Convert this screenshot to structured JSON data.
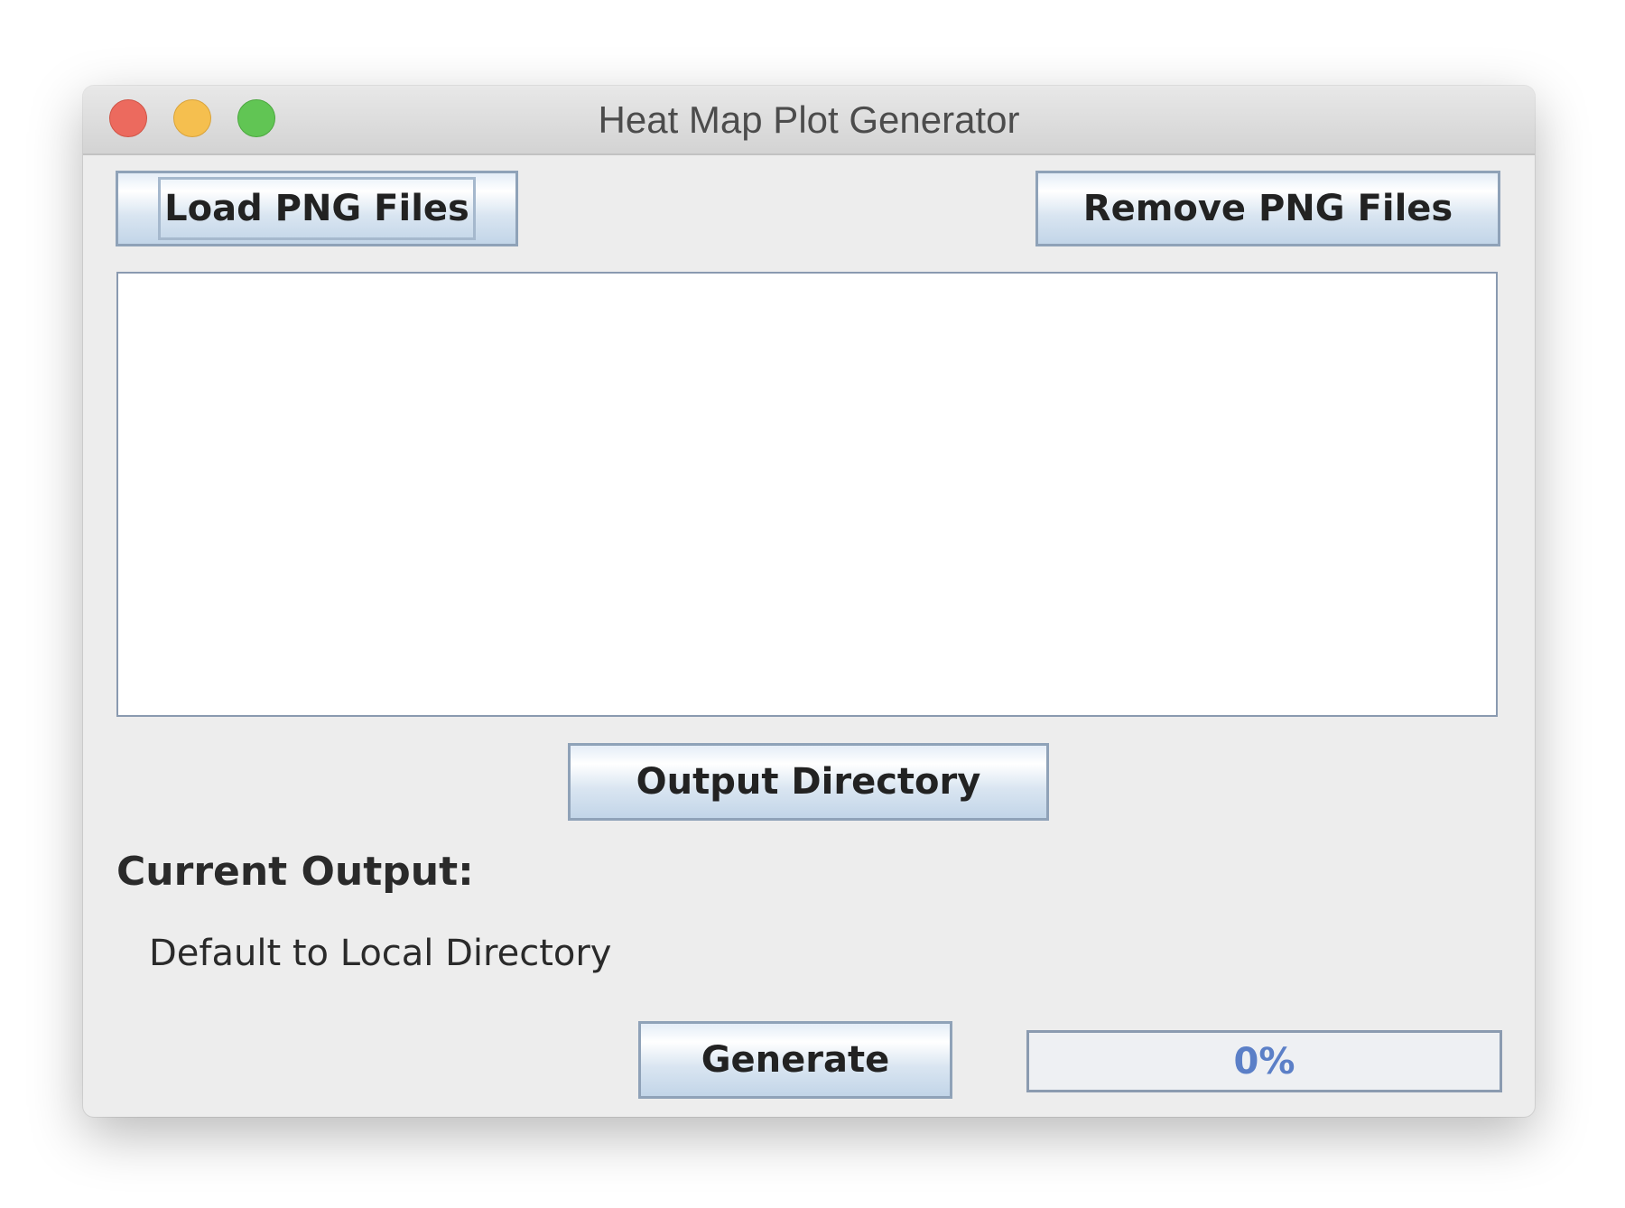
{
  "window": {
    "title": "Heat Map Plot Generator"
  },
  "toolbar": {
    "load_label": "Load PNG Files",
    "remove_label": "Remove PNG Files"
  },
  "file_list": {
    "items": []
  },
  "output": {
    "directory_button": "Output Directory",
    "current_label": "Current Output:",
    "current_value": "Default to Local Directory"
  },
  "generate": {
    "label": "Generate"
  },
  "progress": {
    "value": 0,
    "text": "0%",
    "color": "#5b7fc7"
  }
}
